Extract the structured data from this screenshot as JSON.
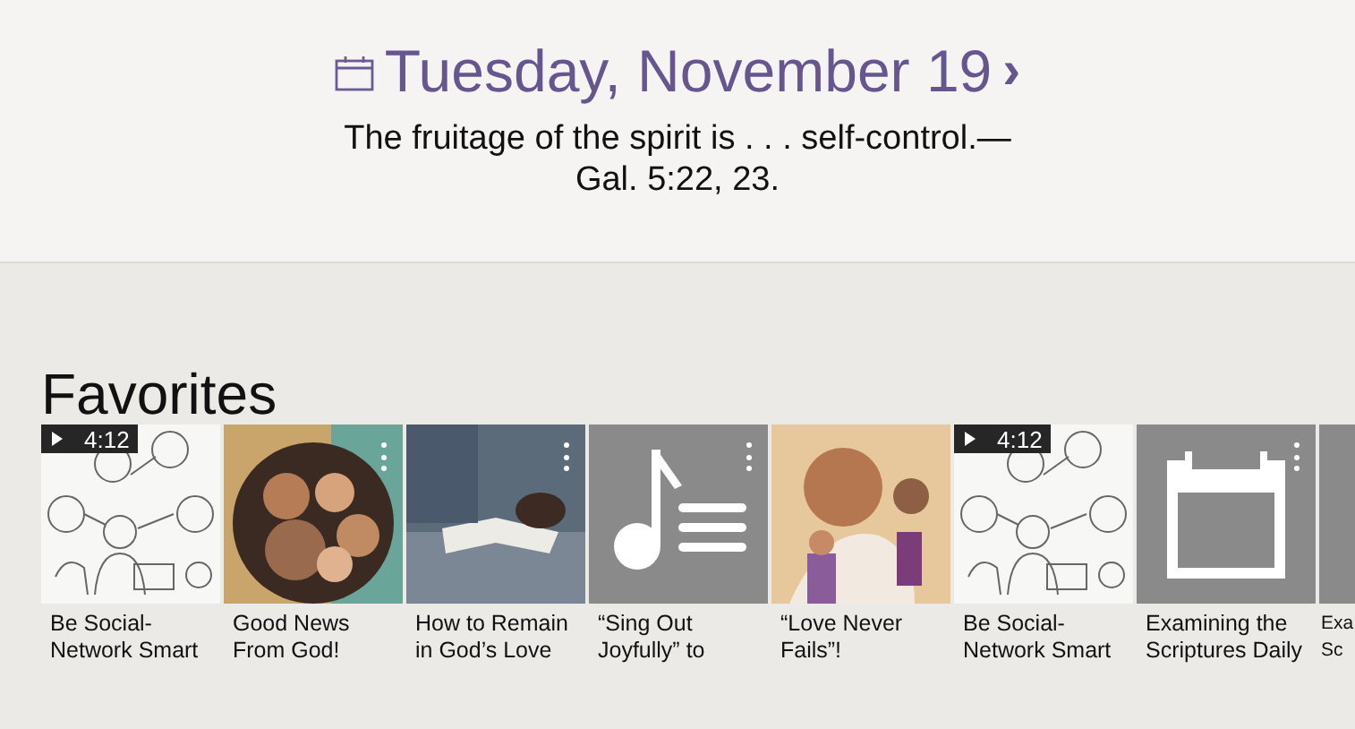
{
  "daily_text": {
    "date": "Tuesday, November 19",
    "next": "›",
    "verse": "The fruitage of the spirit is . . . self-control.—Gal. 5:22, 23."
  },
  "favorites": {
    "heading": "Favorites",
    "items": [
      {
        "kind": "video",
        "title": "Be Social-Network Smart",
        "duration": "4:12"
      },
      {
        "kind": "picture",
        "title": "Good News From God!",
        "menu": true
      },
      {
        "kind": "picture",
        "title": "How to Remain in God’s Love",
        "menu": true
      },
      {
        "kind": "music",
        "title": "“Sing Out Joyfully” to",
        "menu": true
      },
      {
        "kind": "picture",
        "title": "“Love Never Fails”!",
        "menu": false
      },
      {
        "kind": "video",
        "title": "Be Social-Network Smart",
        "duration": "4:12"
      },
      {
        "kind": "calendar",
        "title": "Examining the Scriptures Daily",
        "menu": true
      },
      {
        "kind": "partial",
        "title": "Exa Sc"
      }
    ]
  }
}
